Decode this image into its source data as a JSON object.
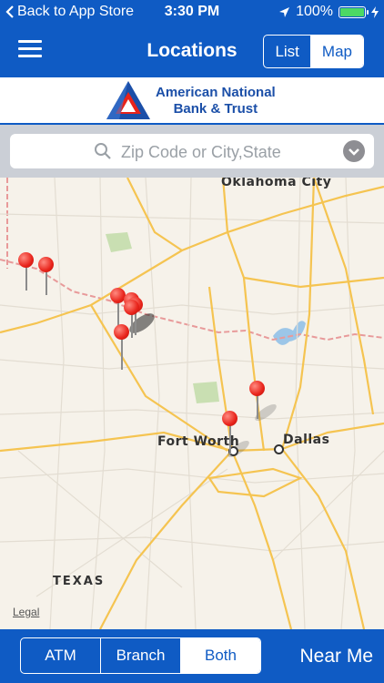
{
  "status_bar": {
    "back_label": "Back to App Store",
    "time": "3:30 PM",
    "battery": "100%",
    "battery_level": 1.0
  },
  "nav": {
    "title": "Locations",
    "view_options": [
      "List",
      "Map"
    ],
    "selected_view": "Map"
  },
  "brand": {
    "line1": "American National",
    "line2": "Bank & Trust",
    "color": "#1b4fa8"
  },
  "search": {
    "placeholder": "Zip Code or City,State",
    "value": ""
  },
  "map": {
    "labels": {
      "oklahoma_city": "Oklahoma City",
      "fort_worth": "Fort Worth",
      "dallas": "Dallas",
      "texas": "TEXAS"
    },
    "legal": "Legal",
    "pin_count": 9
  },
  "filter": {
    "atm": "ATM",
    "branch": "Branch",
    "both": "Both",
    "selected": "Both"
  },
  "near_me": "Near Me",
  "colors": {
    "primary": "#0f5bc4",
    "pin": "#e8231a",
    "battery": "#4cd964"
  }
}
